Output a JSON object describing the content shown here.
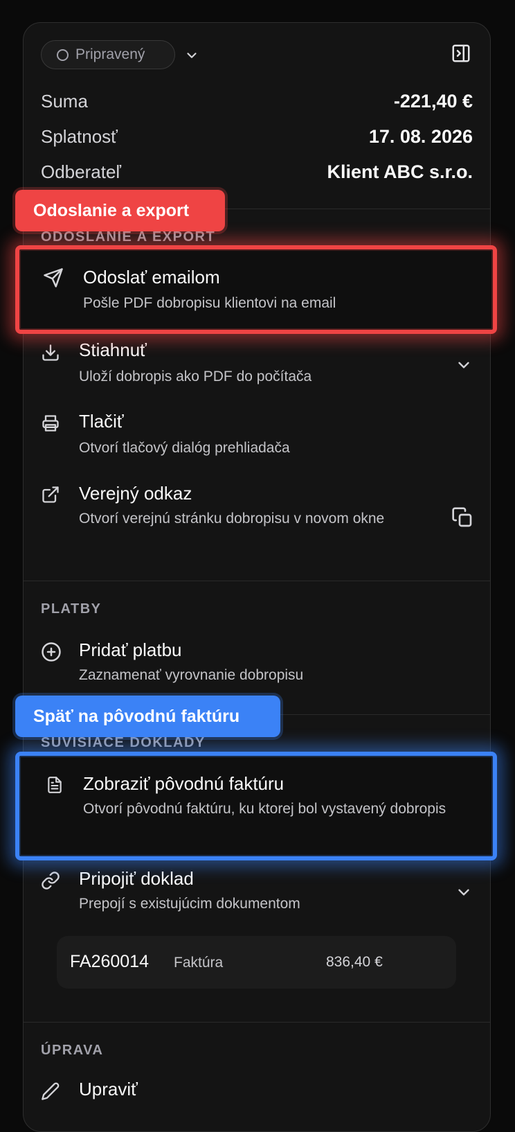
{
  "status": {
    "label": "Pripravený"
  },
  "summary": [
    {
      "key": "Suma",
      "value": "-221,40 €"
    },
    {
      "key": "Splatnosť",
      "value": "17. 08. 2026"
    },
    {
      "key": "Odberateľ",
      "value": "Klient ABC s.r.o."
    }
  ],
  "sections": {
    "export": {
      "title": "ODOSLANIE A EXPORT",
      "items": [
        {
          "title": "Odoslať emailom",
          "desc": "Pošle PDF dobropisu klientovi na email",
          "icon": "send-icon"
        },
        {
          "title": "Stiahnuť",
          "desc": "Uloží dobropis ako PDF do počítača",
          "icon": "download-icon"
        },
        {
          "title": "Tlačiť",
          "desc": "Otvorí tlačový dialóg prehliadača",
          "icon": "printer-icon"
        },
        {
          "title": "Verejný odkaz",
          "desc": "Otvorí verejnú stránku dobropisu v novom okne",
          "icon": "external-link-icon"
        }
      ]
    },
    "payments": {
      "title": "PLATBY",
      "items": [
        {
          "title": "Pridať platbu",
          "desc": "Zaznamenať vyrovnanie dobropisu",
          "icon": "plus-circle-icon"
        }
      ]
    },
    "related": {
      "title": "SÚVISIACE DOKLADY",
      "items": [
        {
          "title": "Zobraziť pôvodnú faktúru",
          "desc": "Otvorí pôvodnú faktúru, ku ktorej bol vystavený dobropis",
          "icon": "document-icon"
        },
        {
          "title": "Pripojiť doklad",
          "desc": "Prepojí s existujúcim dokumentom",
          "icon": "link-icon"
        }
      ],
      "document": {
        "number": "FA260014",
        "type": "Faktúra",
        "amount": "836,40 €"
      }
    },
    "edit": {
      "title": "ÚPRAVA",
      "first_item": "Upraviť"
    }
  },
  "annotations": {
    "red": {
      "label": "Odoslanie a export",
      "color": "#ef4444"
    },
    "blue": {
      "label": "Späť na pôvodnú faktúru",
      "color": "#3b82f6"
    }
  }
}
